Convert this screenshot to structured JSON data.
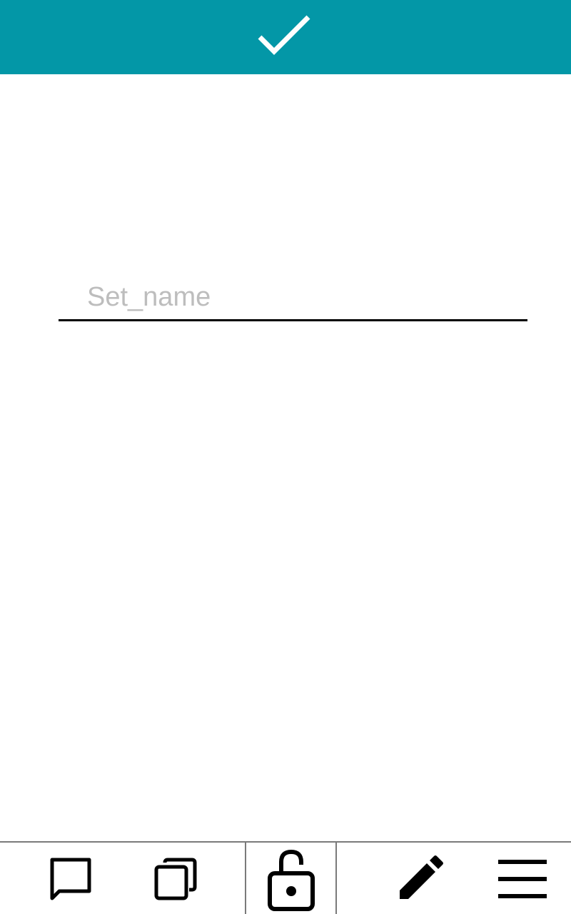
{
  "header": {
    "confirm_icon": "check-icon",
    "background_color": "#0397a7"
  },
  "name_field": {
    "placeholder": "Set_name",
    "value": ""
  },
  "bottom_bar": {
    "items": [
      {
        "name": "comment-button",
        "icon": "chat-bubble-icon"
      },
      {
        "name": "copy-button",
        "icon": "copy-icon"
      },
      {
        "name": "lock-button",
        "icon": "unlocked-padlock-icon"
      },
      {
        "name": "edit-button",
        "icon": "pencil-icon"
      },
      {
        "name": "menu-button",
        "icon": "hamburger-menu-icon"
      }
    ]
  }
}
